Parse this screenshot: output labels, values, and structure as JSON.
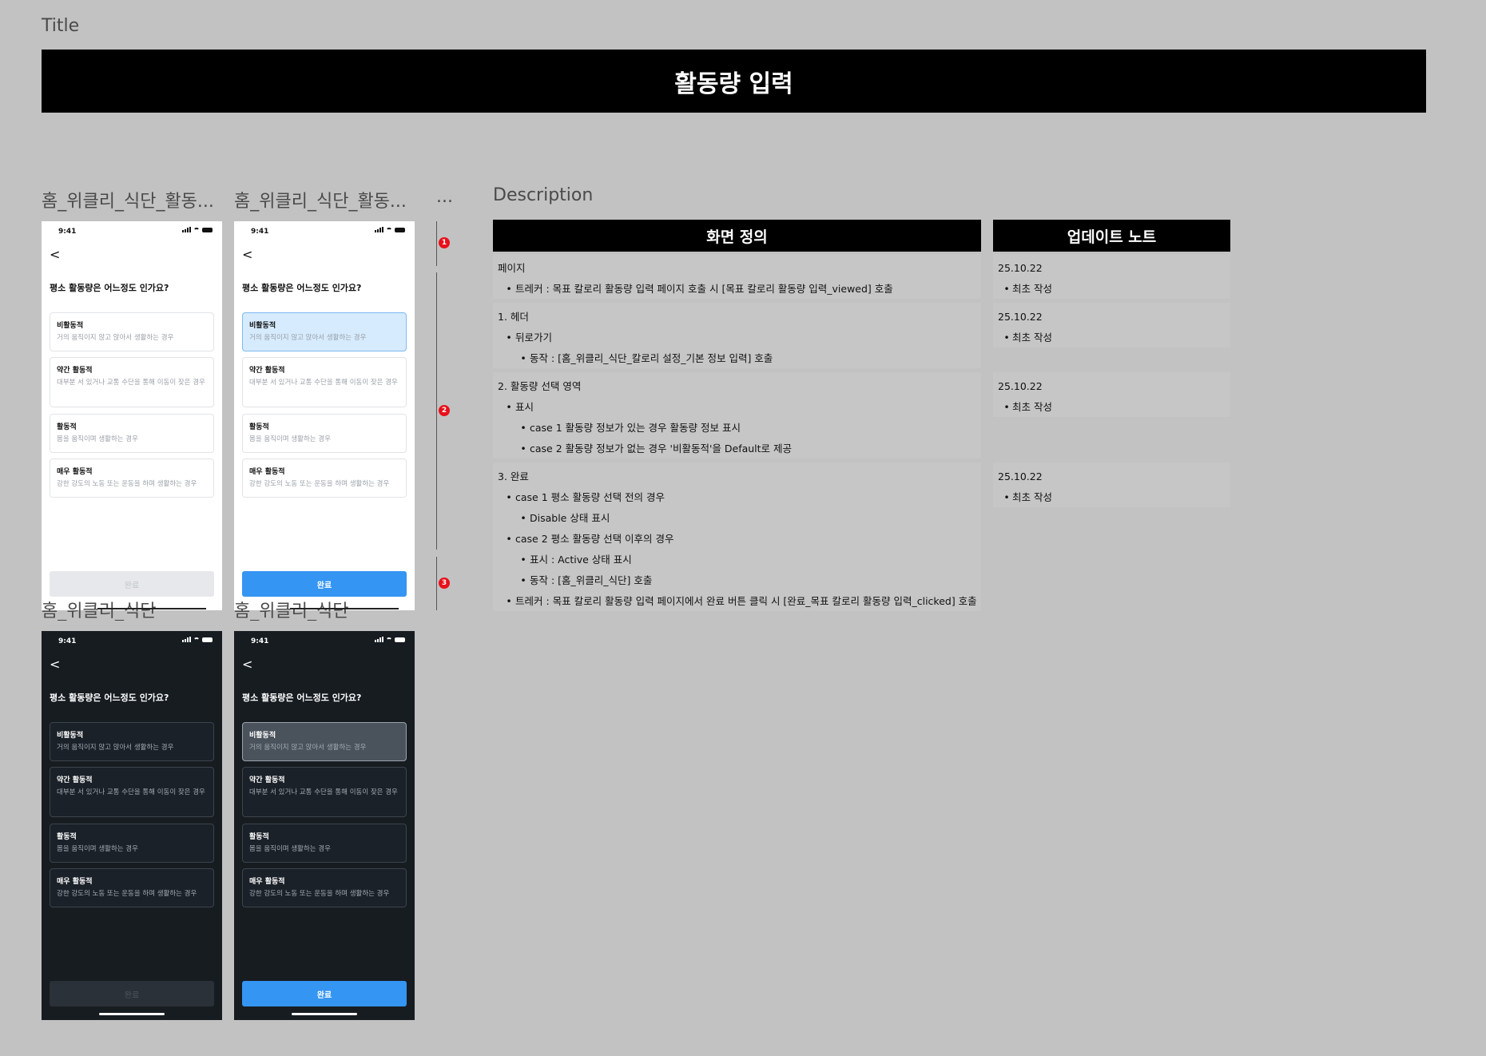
{
  "page": {
    "title_label": "Title",
    "title": "활동량 입력",
    "description_label": "Description",
    "more": "..."
  },
  "frames": {
    "f1_label": "홈_위클리_식단_활동...",
    "f2_label": "홈_위클리_식단_활동...",
    "f3_label": "홈_위클리_식단",
    "f4_label": "홈_위클리_식단"
  },
  "screen": {
    "time": "9:41",
    "back": "<",
    "question": "평소 활동량은 어느정도 인가요?",
    "options": [
      {
        "title": "비활동적",
        "desc": "거의 움직이지 않고 앉아서 생활하는 경우"
      },
      {
        "title": "약간 활동적",
        "desc": "대부분 서 있거나 교통 수단을 통해 이동이 잦은 경우"
      },
      {
        "title": "활동적",
        "desc": "몸을 움직이며 생활하는 경우"
      },
      {
        "title": "매우 활동적",
        "desc": "강한 강도의 노동 또는 운동을 하며 생활하는 경우"
      }
    ],
    "complete": "완료"
  },
  "markers": [
    "1",
    "2",
    "3"
  ],
  "table": {
    "definition_header": "화면 정의",
    "update_header": "업데이트 노트",
    "rows": [
      {
        "lines": [
          "페이지",
          "트레커 : 목표 칼로리 활동량 입력 페이지 호출 시 [목표 칼로리 활동량 입력_viewed] 호출"
        ]
      },
      {
        "lines": [
          "1. 헤더",
          "뒤로가기",
          "동작 : [홈_위클리_식단_칼로리 설정_기본 정보 입력] 호출"
        ]
      },
      {
        "lines": [
          "2. 활동량 선택 영역",
          "표시",
          "case 1 활동량 정보가 있는 경우 활동량 정보 표시",
          "case 2 활동량 정보가 없는 경우 '비활동적'을 Default로 제공"
        ]
      },
      {
        "lines": [
          "3. 완료",
          "case 1 평소 활동량 선택 전의 경우",
          "Disable 상태 표시",
          "case 2 평소 활동량 선택 이후의 경우",
          "표시 : Active 상태 표시",
          "동작 : [홈_위클리_식단] 호출",
          "트레커 : 목표 칼로리 활동량 입력 페이지에서 완료 버튼 클릭 시 [완료_목표 칼로리 활동량 입력_clicked] 호출"
        ]
      }
    ],
    "notes": [
      {
        "date": "25.10.22",
        "note": "최초 작성"
      },
      {
        "date": "25.10.22",
        "note": "최초 작성"
      },
      {
        "date": "25.10.22",
        "note": "최초 작성"
      },
      {
        "date": "25.10.22",
        "note": "최초 작성"
      }
    ]
  }
}
